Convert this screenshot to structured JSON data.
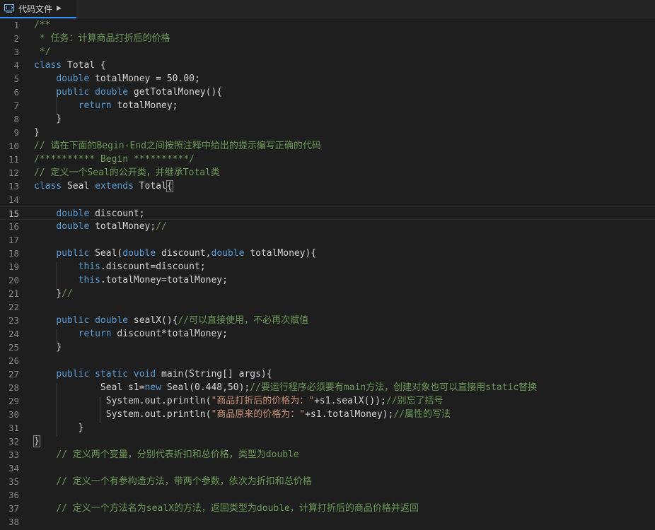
{
  "tab": {
    "label": "代码文件"
  },
  "lines": [
    {
      "n": "1",
      "tokens": [
        [
          "cm",
          "/**"
        ]
      ]
    },
    {
      "n": "2",
      "tokens": [
        [
          "cm",
          " * 任务：计算商品打折后的价格"
        ]
      ]
    },
    {
      "n": "3",
      "tokens": [
        [
          "cm",
          " */"
        ]
      ]
    },
    {
      "n": "4",
      "tokens": [
        [
          "kw",
          "class"
        ],
        [
          "def",
          " Total {"
        ]
      ]
    },
    {
      "n": "5",
      "tokens": [
        [
          "def",
          "    "
        ],
        [
          "kw",
          "double"
        ],
        [
          "def",
          " totalMoney = 50.00;"
        ]
      ]
    },
    {
      "n": "6",
      "tokens": [
        [
          "def",
          "    "
        ],
        [
          "kw",
          "public"
        ],
        [
          "def",
          " "
        ],
        [
          "kw",
          "double"
        ],
        [
          "def",
          " getTotalMoney(){"
        ]
      ]
    },
    {
      "n": "7",
      "tokens": [
        [
          "def",
          "        "
        ],
        [
          "kw",
          "return"
        ],
        [
          "def",
          " totalMoney;"
        ]
      ]
    },
    {
      "n": "8",
      "tokens": [
        [
          "def",
          "    }"
        ]
      ]
    },
    {
      "n": "9",
      "tokens": [
        [
          "def",
          "}"
        ]
      ]
    },
    {
      "n": "10",
      "tokens": [
        [
          "cm",
          "// 请在下面的Begin-End之间按照注释中给出的提示编写正确的代码"
        ]
      ]
    },
    {
      "n": "11",
      "tokens": [
        [
          "cm",
          "/********** Begin **********/"
        ]
      ]
    },
    {
      "n": "12",
      "tokens": [
        [
          "cm",
          "// 定义一个Seal的公开类，并继承Total类"
        ]
      ]
    },
    {
      "n": "13",
      "tokens": [
        [
          "kw",
          "class"
        ],
        [
          "def",
          " Seal "
        ],
        [
          "kw",
          "extends"
        ],
        [
          "def",
          " Total"
        ],
        [
          "bm",
          "{"
        ]
      ]
    },
    {
      "n": "14",
      "tokens": []
    },
    {
      "n": "15",
      "tokens": [
        [
          "def",
          "    "
        ],
        [
          "kw",
          "double"
        ],
        [
          "def",
          " discount;"
        ]
      ],
      "active": true
    },
    {
      "n": "16",
      "tokens": [
        [
          "def",
          "    "
        ],
        [
          "kw",
          "double"
        ],
        [
          "def",
          " totalMoney;"
        ],
        [
          "cm",
          "//"
        ]
      ]
    },
    {
      "n": "17",
      "tokens": []
    },
    {
      "n": "18",
      "tokens": [
        [
          "def",
          "    "
        ],
        [
          "kw",
          "public"
        ],
        [
          "def",
          " Seal("
        ],
        [
          "kw",
          "double"
        ],
        [
          "def",
          " discount,"
        ],
        [
          "kw",
          "double"
        ],
        [
          "def",
          " totalMoney){"
        ]
      ]
    },
    {
      "n": "19",
      "tokens": [
        [
          "def",
          "        "
        ],
        [
          "kw",
          "this"
        ],
        [
          "def",
          ".discount=discount;"
        ]
      ]
    },
    {
      "n": "20",
      "tokens": [
        [
          "def",
          "        "
        ],
        [
          "kw",
          "this"
        ],
        [
          "def",
          ".totalMoney=totalMoney;"
        ]
      ]
    },
    {
      "n": "21",
      "tokens": [
        [
          "def",
          "    }"
        ],
        [
          "cm",
          "//"
        ]
      ]
    },
    {
      "n": "22",
      "tokens": []
    },
    {
      "n": "23",
      "tokens": [
        [
          "def",
          "    "
        ],
        [
          "kw",
          "public"
        ],
        [
          "def",
          " "
        ],
        [
          "kw",
          "double"
        ],
        [
          "def",
          " sealX(){"
        ],
        [
          "cm",
          "//可以直接使用，不必再次赋值"
        ]
      ]
    },
    {
      "n": "24",
      "tokens": [
        [
          "def",
          "        "
        ],
        [
          "kw",
          "return"
        ],
        [
          "def",
          " discount*totalMoney;"
        ]
      ]
    },
    {
      "n": "25",
      "tokens": [
        [
          "def",
          "    }"
        ]
      ]
    },
    {
      "n": "26",
      "tokens": []
    },
    {
      "n": "27",
      "tokens": [
        [
          "def",
          "    "
        ],
        [
          "kw",
          "public"
        ],
        [
          "def",
          " "
        ],
        [
          "kw",
          "static"
        ],
        [
          "def",
          " "
        ],
        [
          "kw",
          "void"
        ],
        [
          "def",
          " main(String[] args){"
        ]
      ]
    },
    {
      "n": "28",
      "tokens": [
        [
          "def",
          "            Seal s1="
        ],
        [
          "kw",
          "new"
        ],
        [
          "def",
          " Seal(0.448,50);"
        ],
        [
          "cm",
          "//要运行程序必须要有main方法，创建对象也可以直接用static替换"
        ]
      ]
    },
    {
      "n": "29",
      "tokens": [
        [
          "def",
          "             System.out.println("
        ],
        [
          "str",
          "\"商品打折后的价格为：\""
        ],
        [
          "def",
          "+s1.sealX());"
        ],
        [
          "cm",
          "//别忘了括号"
        ]
      ]
    },
    {
      "n": "30",
      "tokens": [
        [
          "def",
          "             System.out.println("
        ],
        [
          "str",
          "\"商品原来的价格为：\""
        ],
        [
          "def",
          "+s1.totalMoney);"
        ],
        [
          "cm",
          "//属性的写法"
        ]
      ]
    },
    {
      "n": "31",
      "tokens": [
        [
          "def",
          "        }"
        ]
      ]
    },
    {
      "n": "32",
      "tokens": [
        [
          "bm",
          "}"
        ]
      ]
    },
    {
      "n": "33",
      "tokens": [
        [
          "def",
          "    "
        ],
        [
          "cm",
          "// 定义两个变量，分别代表折扣和总价格，类型为double"
        ]
      ]
    },
    {
      "n": "34",
      "tokens": []
    },
    {
      "n": "35",
      "tokens": [
        [
          "def",
          "    "
        ],
        [
          "cm",
          "// 定义一个有参构造方法，带两个参数，依次为折扣和总价格"
        ]
      ]
    },
    {
      "n": "36",
      "tokens": []
    },
    {
      "n": "37",
      "tokens": [
        [
          "def",
          "    "
        ],
        [
          "cm",
          "// 定义一个方法名为sealX的方法，返回类型为double，计算打折后的商品价格并返回"
        ]
      ]
    },
    {
      "n": "38",
      "tokens": []
    }
  ]
}
